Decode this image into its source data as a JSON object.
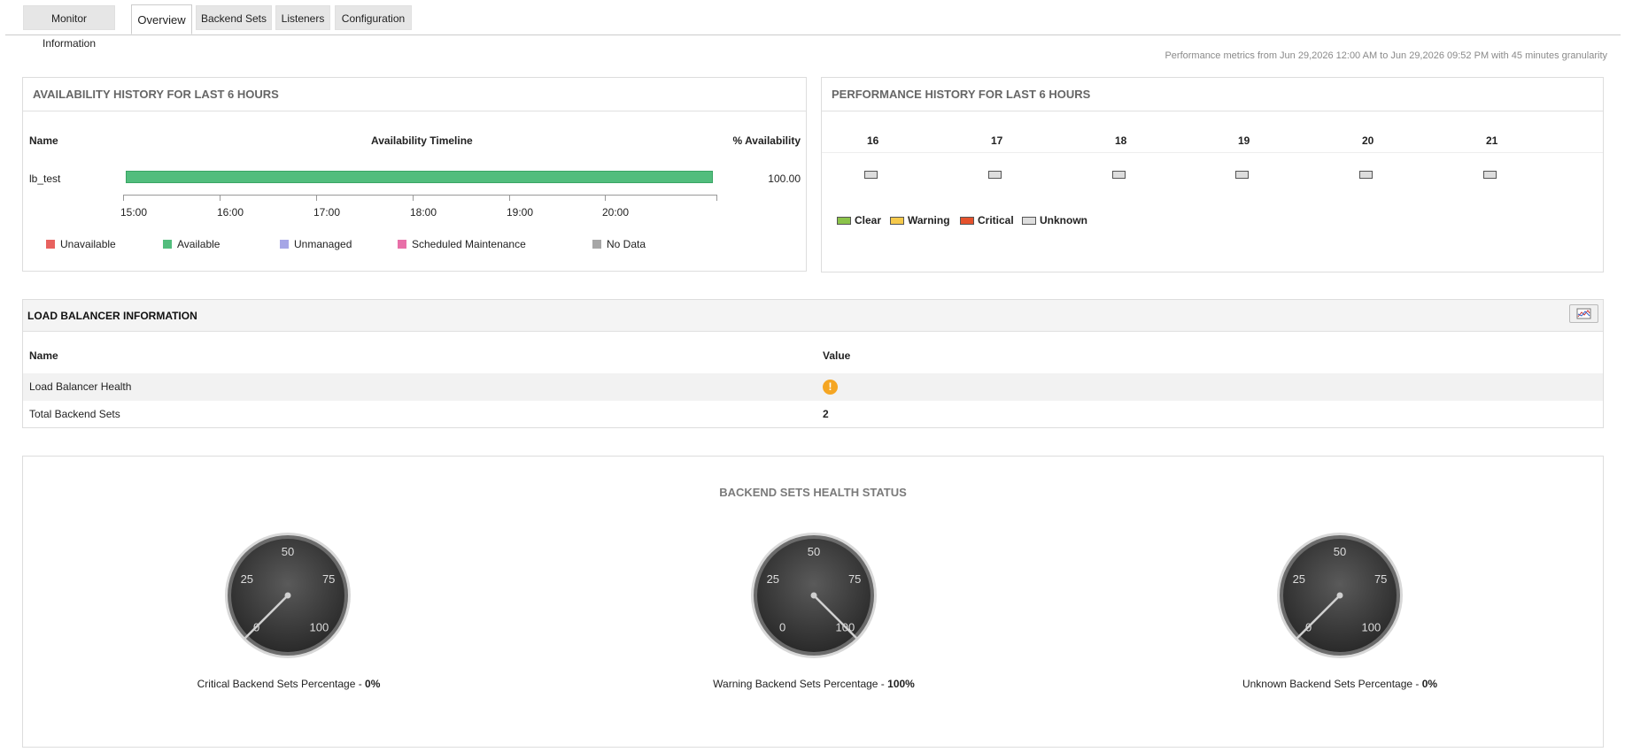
{
  "tabs": [
    "Monitor Information",
    "Overview",
    "Backend Sets",
    "Listeners",
    "Configuration"
  ],
  "active_tab": "Overview",
  "perf_range": "Performance metrics from Jun 29,2026 12:00 AM to Jun 29,2026 09:52 PM with 45 minutes granularity",
  "availability": {
    "title": "AVAILABILITY HISTORY FOR LAST 6 HOURS",
    "col_name": "Name",
    "col_timeline": "Availability Timeline",
    "col_pct": "% Availability",
    "row": {
      "name": "lb_test",
      "pct": "100.00",
      "status": "Available"
    },
    "axis": [
      "15:00",
      "16:00",
      "17:00",
      "18:00",
      "19:00",
      "20:00"
    ],
    "legend": [
      {
        "label": "Unavailable",
        "color": "#e8625f"
      },
      {
        "label": "Available",
        "color": "#52bd7d"
      },
      {
        "label": "Unmanaged",
        "color": "#a6a6e6"
      },
      {
        "label": "Scheduled Maintenance",
        "color": "#e86fa8"
      },
      {
        "label": "No Data",
        "color": "#a6a6a6"
      }
    ]
  },
  "performance": {
    "title": "PERFORMANCE HISTORY FOR LAST 6 HOURS",
    "hours": [
      "16",
      "17",
      "18",
      "19",
      "20",
      "21"
    ],
    "legend": [
      {
        "label": "Clear",
        "color": "#8bc34a"
      },
      {
        "label": "Warning",
        "color": "#f6c94b"
      },
      {
        "label": "Critical",
        "color": "#e5522d"
      },
      {
        "label": "Unknown",
        "color": "#dddddd"
      }
    ]
  },
  "lb_info": {
    "title": "LOAD BALANCER INFORMATION",
    "col_name": "Name",
    "col_value": "Value",
    "rows": [
      {
        "name": "Load Balancer Health",
        "value": "!",
        "status": "warning"
      },
      {
        "name": "Total Backend Sets",
        "value": "2"
      }
    ]
  },
  "health": {
    "title": "BACKEND SETS HEALTH STATUS",
    "gauge_labels": [
      "0",
      "25",
      "50",
      "75",
      "100"
    ],
    "gauges": [
      {
        "caption": "Critical Backend Sets Percentage - ",
        "value": 0,
        "value_text": "0%"
      },
      {
        "caption": "Warning Backend Sets Percentage - ",
        "value": 100,
        "value_text": "100%"
      },
      {
        "caption": "Unknown Backend Sets Percentage - ",
        "value": 0,
        "value_text": "0%"
      }
    ]
  },
  "colors": {
    "available": "#52bd7d",
    "warning": "#f5a623",
    "gauge_dark": "#2f2f2f"
  }
}
